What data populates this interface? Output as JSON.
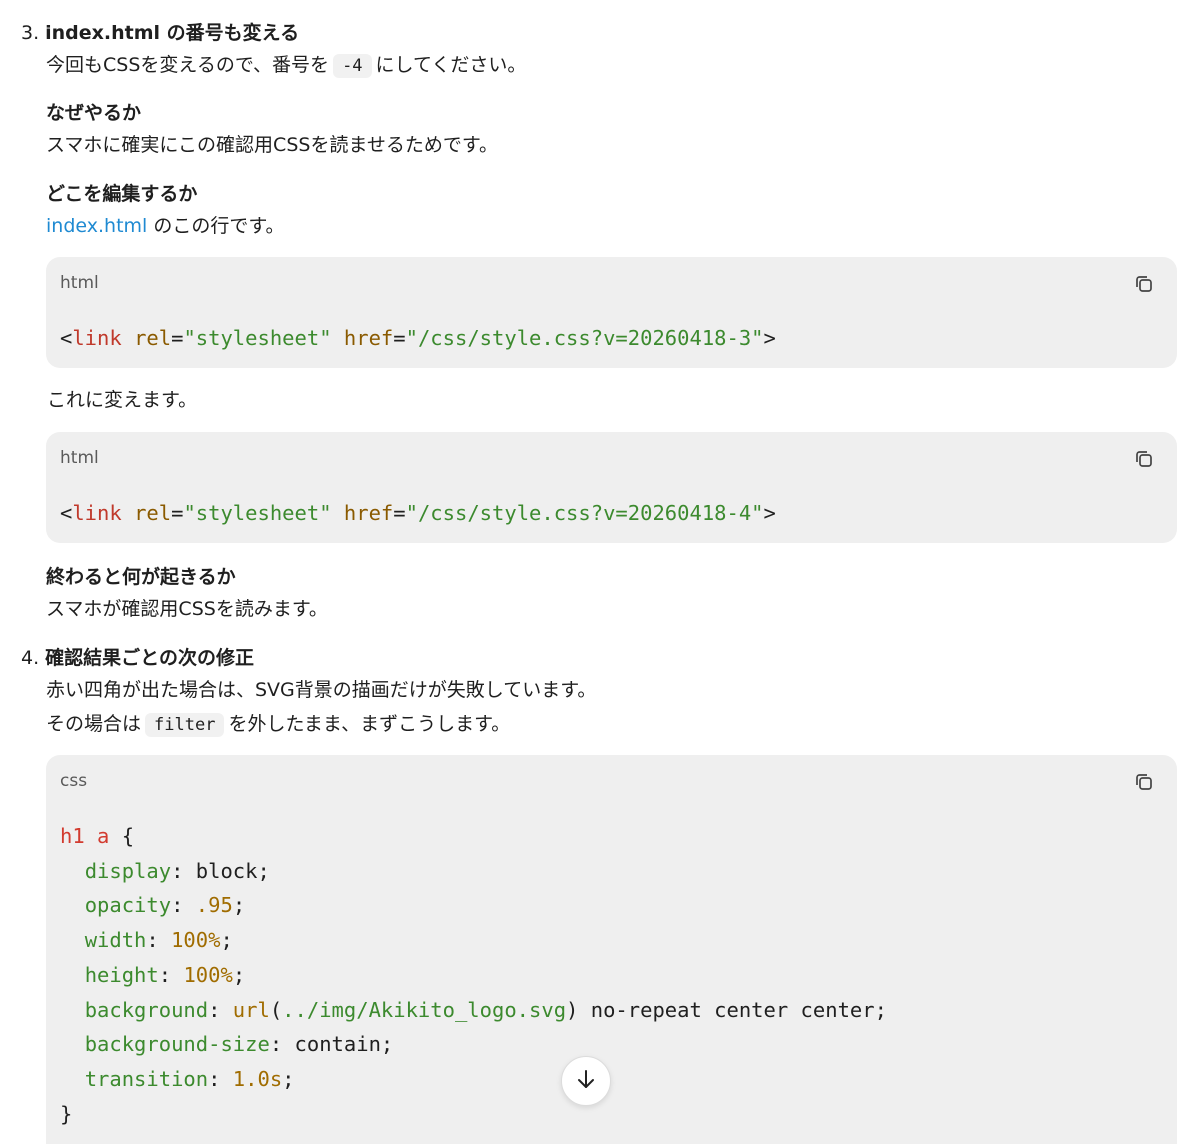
{
  "step3": {
    "number": "3.",
    "title": "index.html の番号も変える",
    "intro_before": "今回もCSSを変えるので、番号を",
    "intro_code": "-4",
    "intro_after": "にしてください。",
    "why_heading": "なぜやるか",
    "why_text": "スマホに確実にこの確認用CSSを読ませるためです。",
    "where_heading": "どこを編集するか",
    "where_link": "index.html",
    "where_text": " のこの行です。",
    "code_before": {
      "lang": "html",
      "open": "<",
      "tag": "link",
      "attr1": "rel",
      "eq": "=",
      "val1": "\"stylesheet\"",
      "attr2": "href",
      "val2": "\"/css/style.css?v=20260418-3\"",
      "close": ">"
    },
    "change_text": "これに変えます。",
    "code_after": {
      "lang": "html",
      "open": "<",
      "tag": "link",
      "attr1": "rel",
      "eq": "=",
      "val1": "\"stylesheet\"",
      "attr2": "href",
      "val2": "\"/css/style.css?v=20260418-4\"",
      "close": ">"
    },
    "result_heading": "終わると何が起きるか",
    "result_text": "スマホが確認用CSSを読みます。"
  },
  "step4": {
    "number": "4.",
    "title": "確認結果ごとの次の修正",
    "line1": "赤い四角が出た場合は、SVG背景の描画だけが失敗しています。",
    "line2_before": "その場合は",
    "line2_code": "filter",
    "line2_after": "を外したまま、まずこうします。",
    "code": {
      "lang": "css",
      "selector": "h1 a",
      "brace_open": " {",
      "brace_close": "}",
      "decls": [
        {
          "prop": "display",
          "value": "block",
          "kind": "plain"
        },
        {
          "prop": "opacity",
          "value": ".95",
          "kind": "num"
        },
        {
          "prop": "width",
          "value": "100%",
          "kind": "num"
        },
        {
          "prop": "height",
          "value": "100%",
          "kind": "num"
        },
        {
          "prop": "background",
          "fn": "url",
          "arg": "../img/Akikito_logo.svg",
          "rest": " no-repeat center center",
          "kind": "url"
        },
        {
          "prop": "background-size",
          "value": "contain",
          "kind": "plain"
        },
        {
          "prop": "transition",
          "value": "1.0s",
          "kind": "num"
        }
      ]
    }
  },
  "icons": {
    "copy": "copy-icon",
    "scroll": "arrow-down-icon"
  }
}
